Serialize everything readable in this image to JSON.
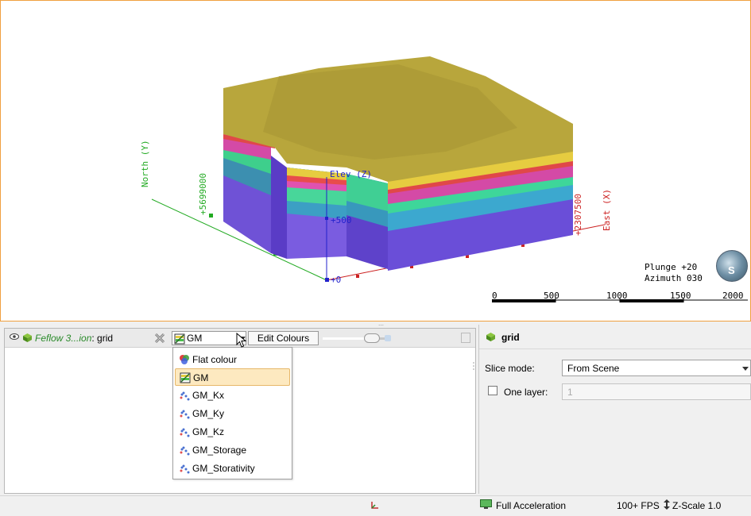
{
  "scene": {
    "axis_north_label": "North (Y)",
    "axis_east_label": "East (X)",
    "axis_elev_label": "Elev (Z)",
    "north_tick": "+5699000",
    "east_tick": "+2307500",
    "elev_tick_500": "+500",
    "elev_tick_0": "+0",
    "plunge": "Plunge +20",
    "azimuth": "Azimuth 030",
    "compass_letter": "S",
    "scale_ticks": [
      "0",
      "500",
      "1000",
      "1500",
      "2000"
    ]
  },
  "left_panel": {
    "title_italic": "Feflow 3...ion",
    "title_rest": ": grid",
    "selected_colour": "GM",
    "edit_colours": "Edit Colours",
    "dropdown_items": [
      {
        "label": "Flat colour",
        "icon": "flat-colour-icon",
        "selected": false
      },
      {
        "label": "GM",
        "icon": "gm-icon",
        "selected": true
      },
      {
        "label": "GM_Kx",
        "icon": "scatter-icon",
        "selected": false
      },
      {
        "label": "GM_Ky",
        "icon": "scatter-icon",
        "selected": false
      },
      {
        "label": "GM_Kz",
        "icon": "scatter-icon",
        "selected": false
      },
      {
        "label": "GM_Storage",
        "icon": "scatter-icon",
        "selected": false
      },
      {
        "label": "GM_Storativity",
        "icon": "scatter-icon",
        "selected": false
      }
    ]
  },
  "right_panel": {
    "title": "grid",
    "slice_mode_label": "Slice mode:",
    "slice_mode_value": "From Scene",
    "one_layer_label": "One layer:",
    "one_layer_value": "1"
  },
  "status_bar": {
    "acceleration": "Full Acceleration",
    "fps": "100+ FPS",
    "zscale": "Z-Scale 1.0"
  },
  "colors": {
    "accent": "#f0a040",
    "selection": "#fde9c0",
    "north_axis": "#22aa22",
    "east_axis": "#cc2222",
    "elev_axis": "#2222cc"
  }
}
